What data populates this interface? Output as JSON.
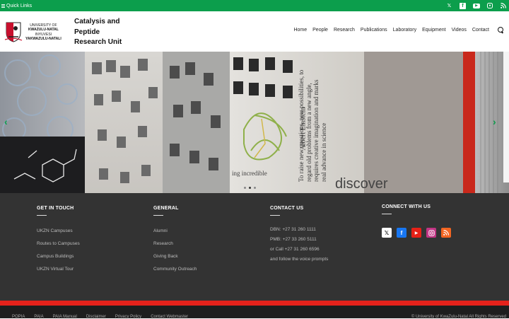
{
  "topbar": {
    "quick_links": "Quick Links",
    "socials": [
      {
        "icon": "x-icon",
        "glyph": "𝕏"
      },
      {
        "icon": "facebook-icon",
        "glyph": "f"
      },
      {
        "icon": "youtube-icon",
        "glyph": "▶"
      },
      {
        "icon": "instagram-icon",
        "glyph": "◎"
      },
      {
        "icon": "rss-icon",
        "glyph": ")"
      }
    ]
  },
  "header": {
    "logo_line1": "UNIVERSITY OF",
    "logo_line2": "KWAZULU-NATAL",
    "logo_line3": "INYUVESI",
    "logo_line4": "YAKWAZULU-NATALI",
    "unit_title": "Catalysis and Peptide Research Unit",
    "nav": [
      "Home",
      "People",
      "Research",
      "Publications",
      "Laboratory",
      "Equipment",
      "Videos",
      "Contact"
    ]
  },
  "hero": {
    "quote_text": "To raise new questions, new possibilities, to regard old problems from a new angle, requires creative imagination and marks real advance in science",
    "quote_author": "Albert Einstein",
    "word1": "discover",
    "word2": "ing incredible"
  },
  "footer": {
    "get_in_touch": {
      "title": "GET IN TOUCH",
      "items": [
        "UKZN Campuses",
        "Routes to Campuses",
        "Campus Buildings",
        "UKZN Virtual Tour"
      ]
    },
    "general": {
      "title": "GENERAL",
      "items": [
        "Alumni",
        "Research",
        "Giving Back",
        "Community Outreach"
      ]
    },
    "contact": {
      "title": "CONTACT US",
      "items": [
        "DBN: +27 31 260 1111",
        "PMB: +27 33 260 5111",
        "or Call +27 31 260 6596",
        "and follow the voice prompts"
      ]
    },
    "connect": {
      "title": "CONNECT WITH US"
    }
  },
  "bottom": {
    "links": [
      "POPIA",
      "PAIA",
      "PAIA Manual",
      "Disclaimer",
      "Privacy Policy",
      "Contact Webmaster"
    ],
    "copyright": "© University of KwaZulu-Natal All Rights Reserved"
  },
  "colors": {
    "brand_green": "#0c9e4c",
    "footer_bg": "#333333",
    "accent_red": "#e5221b"
  }
}
